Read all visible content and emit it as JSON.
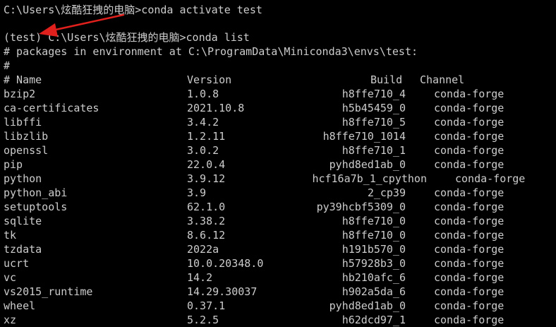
{
  "window": {
    "background": "#000000",
    "text_color": "#cccccc",
    "annotation_color": "#e0201c"
  },
  "session": {
    "lines": [
      "C:\\Users\\炫酷狂拽的电脑>conda activate test",
      "",
      "(test) C:\\Users\\炫酷狂拽的电脑>conda list",
      "# packages in environment at C:\\ProgramData\\Miniconda3\\envs\\test:",
      "#"
    ]
  },
  "table": {
    "headers": {
      "name": "# Name",
      "version": "Version",
      "build": "Build",
      "channel": "Channel"
    },
    "rows": [
      {
        "name": "bzip2",
        "version": "1.0.8",
        "build": "h8ffe710_4",
        "channel": "conda-forge"
      },
      {
        "name": "ca-certificates",
        "version": "2021.10.8",
        "build": "h5b45459_0",
        "channel": "conda-forge"
      },
      {
        "name": "libffi",
        "version": "3.4.2",
        "build": "h8ffe710_5",
        "channel": "conda-forge"
      },
      {
        "name": "libzlib",
        "version": "1.2.11",
        "build": "h8ffe710_1014",
        "channel": "conda-forge"
      },
      {
        "name": "openssl",
        "version": "3.0.2",
        "build": "h8ffe710_1",
        "channel": "conda-forge"
      },
      {
        "name": "pip",
        "version": "22.0.4",
        "build": "pyhd8ed1ab_0",
        "channel": "conda-forge"
      },
      {
        "name": "python",
        "version": "3.9.12",
        "build": "hcf16a7b_1_cpython",
        "channel": "conda-forge"
      },
      {
        "name": "python_abi",
        "version": "3.9",
        "build": "2_cp39",
        "channel": "conda-forge"
      },
      {
        "name": "setuptools",
        "version": "62.1.0",
        "build": "py39hcbf5309_0",
        "channel": "conda-forge"
      },
      {
        "name": "sqlite",
        "version": "3.38.2",
        "build": "h8ffe710_0",
        "channel": "conda-forge"
      },
      {
        "name": "tk",
        "version": "8.6.12",
        "build": "h8ffe710_0",
        "channel": "conda-forge"
      },
      {
        "name": "tzdata",
        "version": "2022a",
        "build": "h191b570_0",
        "channel": "conda-forge"
      },
      {
        "name": "ucrt",
        "version": "10.0.20348.0",
        "build": "h57928b3_0",
        "channel": "conda-forge"
      },
      {
        "name": "vc",
        "version": "14.2",
        "build": "hb210afc_6",
        "channel": "conda-forge"
      },
      {
        "name": "vs2015_runtime",
        "version": "14.29.30037",
        "build": "h902a5da_6",
        "channel": "conda-forge"
      },
      {
        "name": "wheel",
        "version": "0.37.1",
        "build": "pyhd8ed1ab_0",
        "channel": "conda-forge"
      },
      {
        "name": "xz",
        "version": "5.2.5",
        "build": "h62dcd97_1",
        "channel": "conda-forge"
      }
    ]
  }
}
